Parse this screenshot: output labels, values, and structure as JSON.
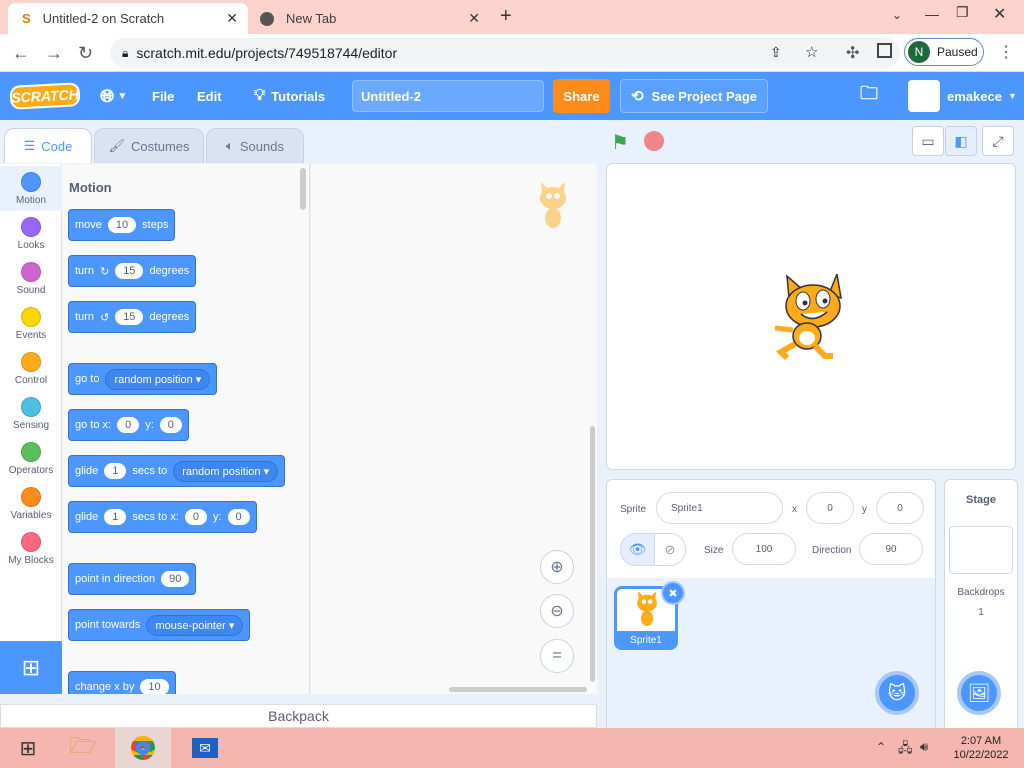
{
  "browser": {
    "tabs": [
      {
        "title": "Untitled-2 on Scratch"
      },
      {
        "title": "New Tab"
      }
    ],
    "url": "scratch.mit.edu/projects/749518744/editor",
    "profile_initial": "N",
    "profile_status": "Paused"
  },
  "menubar": {
    "logo": "SCRATCH",
    "file": "File",
    "edit": "Edit",
    "tutorials": "Tutorials",
    "project_title": "Untitled-2",
    "share": "Share",
    "see_project": "See Project Page",
    "username": "emakece"
  },
  "editor_tabs": {
    "code": "Code",
    "costumes": "Costumes",
    "sounds": "Sounds"
  },
  "categories": [
    {
      "label": "Motion",
      "color": "#4c97ff"
    },
    {
      "label": "Looks",
      "color": "#9966ff"
    },
    {
      "label": "Sound",
      "color": "#cf63cf"
    },
    {
      "label": "Events",
      "color": "#ffd500"
    },
    {
      "label": "Control",
      "color": "#ffab19"
    },
    {
      "label": "Sensing",
      "color": "#4cbfe6"
    },
    {
      "label": "Operators",
      "color": "#59c059"
    },
    {
      "label": "Variables",
      "color": "#ff8c1a"
    },
    {
      "label": "My Blocks",
      "color": "#ff6680"
    }
  ],
  "palette": {
    "heading": "Motion",
    "move": {
      "a": "move",
      "v": "10",
      "b": "steps"
    },
    "turn_right": {
      "a": "turn",
      "v": "15",
      "b": "degrees"
    },
    "turn_left": {
      "a": "turn",
      "v": "15",
      "b": "degrees"
    },
    "goto": {
      "a": "go to",
      "d": "random position"
    },
    "gotoxy": {
      "a": "go to x:",
      "x": "0",
      "b": "y:",
      "y": "0"
    },
    "glide_to": {
      "a": "glide",
      "v": "1",
      "b": "secs to",
      "d": "random position"
    },
    "glide_xy": {
      "a": "glide",
      "v": "1",
      "b": "secs to x:",
      "x": "0",
      "c": "y:",
      "y": "0"
    },
    "point_dir": {
      "a": "point in direction",
      "v": "90"
    },
    "point_towards": {
      "a": "point towards",
      "d": "mouse-pointer"
    },
    "change_x": {
      "a": "change x by",
      "v": "10"
    }
  },
  "backpack": "Backpack",
  "sprite_info": {
    "sprite_label": "Sprite",
    "sprite_name": "Sprite1",
    "x_label": "x",
    "x": "0",
    "y_label": "y",
    "y": "0",
    "size_label": "Size",
    "size": "100",
    "direction_label": "Direction",
    "direction": "90"
  },
  "sprite_list": [
    {
      "name": "Sprite1"
    }
  ],
  "stage_pane": {
    "title": "Stage",
    "backdrops_label": "Backdrops",
    "backdrops_count": "1"
  },
  "taskbar": {
    "time": "2:07 AM",
    "date": "10/22/2022"
  }
}
